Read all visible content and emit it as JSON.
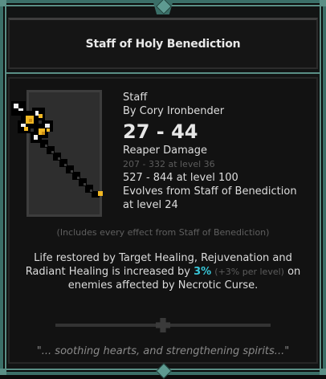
{
  "item": {
    "title": "Staff of Holy Benediction",
    "type": "Staff",
    "author": "By Cory Ironbender",
    "damage": "27 - 44",
    "damage_type": "Reaper Damage",
    "level36_range": "207 - 332 at level 36",
    "level100_range": "527 - 844 at level 100",
    "evolves_from": "Evolves from Staff of Benediction at level 24"
  },
  "effects": {
    "includes_note": "(Includes every effect from Staff of Benediction)",
    "desc_part1": "Life restored by Target Healing, Rejuvenation and Radiant Healing is increased by ",
    "desc_value": "3%",
    "desc_scaling": "(+3% per level)",
    "desc_part2": " on enemies affected by Necrotic Curse."
  },
  "flavor": {
    "quote": "\"... soothing hearts, and strengthening spirits...\""
  },
  "colors": {
    "frame": "#3b6f68",
    "highlight": "#38c6d8",
    "gold": "#f2b823"
  },
  "icons": {
    "weapon": "holy-staff-icon"
  }
}
